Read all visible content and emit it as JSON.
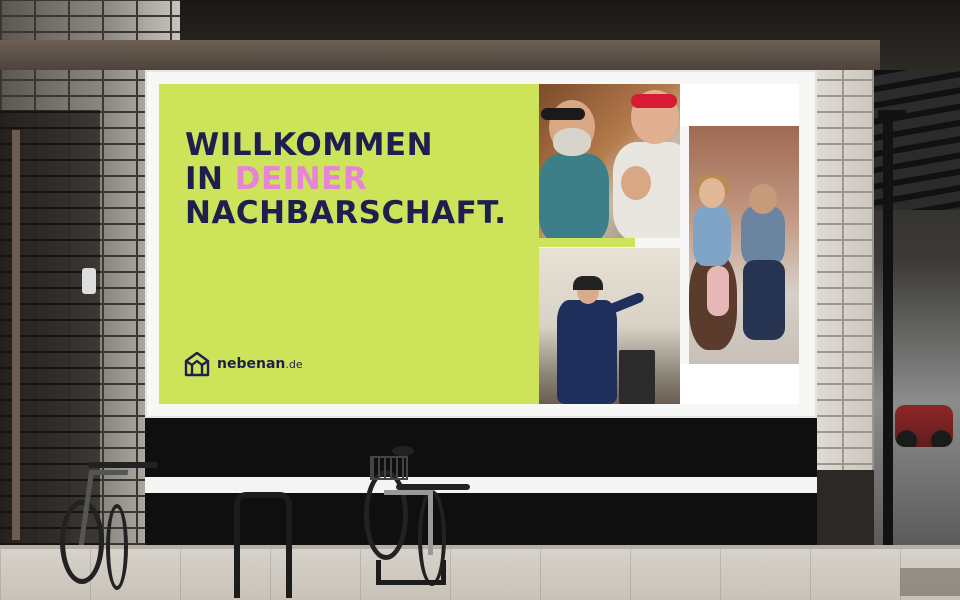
{
  "billboard": {
    "headline": {
      "line1": "WILLKOMMEN",
      "line2_prefix": "IN",
      "line2_accent": "DEINER",
      "line3": "NACHBARSCHAFT."
    },
    "brand": {
      "name": "nebenan",
      "tld": ".de"
    },
    "colors": {
      "panel_green": "#cde45a",
      "headline_navy": "#1f1f4f",
      "accent_pink": "#e884d8"
    }
  },
  "icons": [
    "house-logo-icon"
  ]
}
